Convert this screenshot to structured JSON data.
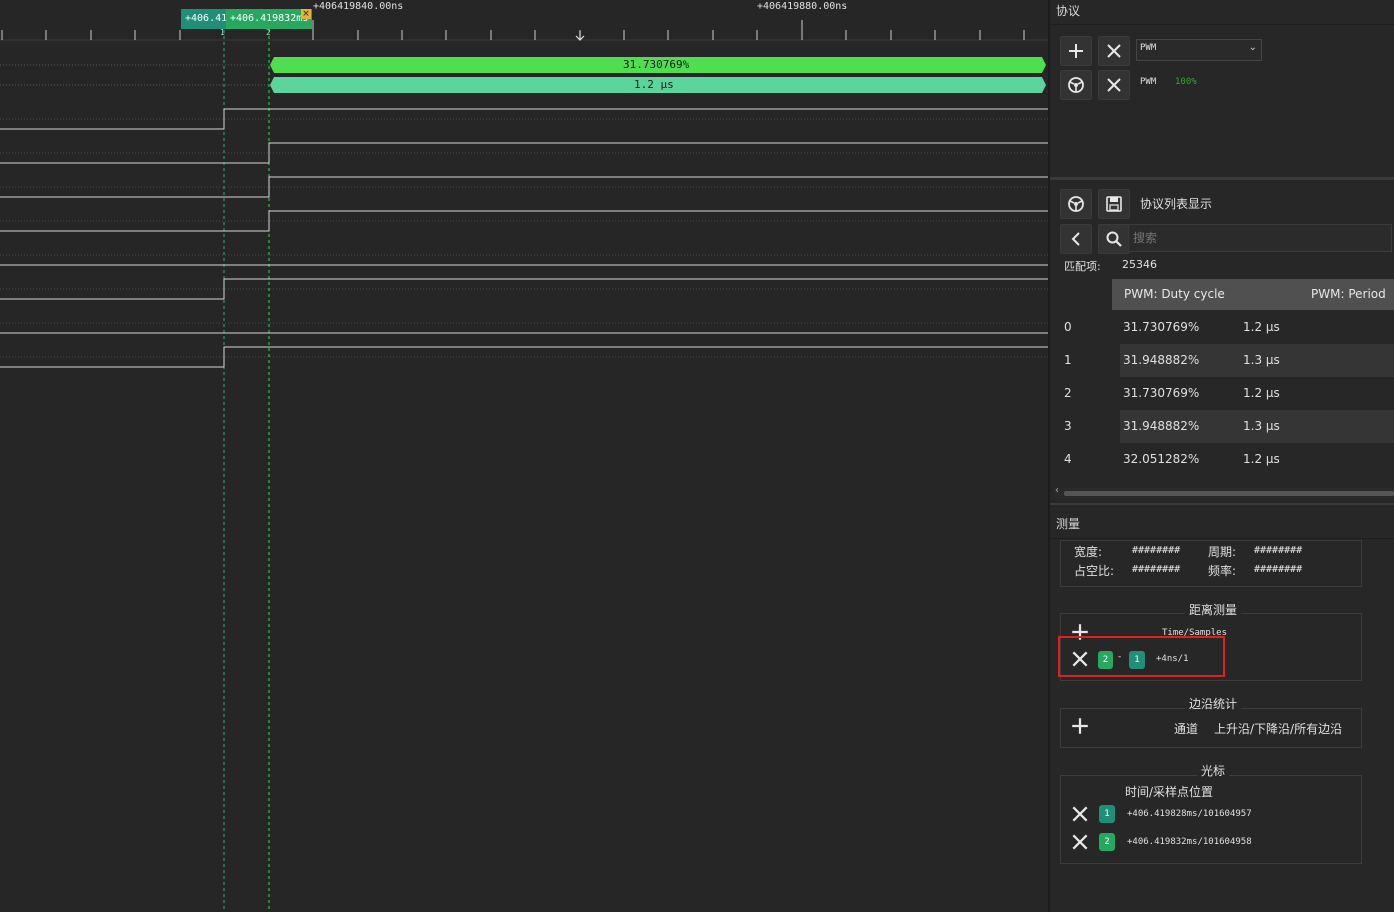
{
  "timeline": {
    "tick1": "+406419840.00ns",
    "tick2": "+406419880.00ns",
    "cursor1_flag": "+406.41",
    "cursor2_flag": "+406.419832ms",
    "cursor1_num": "1",
    "cursor2_num": "2"
  },
  "decode": {
    "duty_bar": "31.730769%",
    "period_bar": "1.2 μs"
  },
  "protocol": {
    "title": "协议",
    "select_value": "PWM",
    "decoder_name": "PWM",
    "decoder_progress": "100%"
  },
  "protocol_list": {
    "title": "协议列表显示",
    "search_placeholder": "搜索",
    "match_label": "匹配项:",
    "match_count": "25346",
    "columns": [
      "PWM: Duty cycle",
      "PWM: Period"
    ],
    "rows": [
      {
        "idx": "0",
        "duty": "31.730769%",
        "period": "1.2 μs"
      },
      {
        "idx": "1",
        "duty": "31.948882%",
        "period": "1.3 μs"
      },
      {
        "idx": "2",
        "duty": "31.730769%",
        "period": "1.2 μs"
      },
      {
        "idx": "3",
        "duty": "31.948882%",
        "period": "1.3 μs"
      },
      {
        "idx": "4",
        "duty": "32.051282%",
        "period": "1.2 μs"
      }
    ]
  },
  "measure": {
    "title": "测量",
    "width_label": "宽度:",
    "width_value": "########",
    "period_label": "周期:",
    "period_value": "########",
    "duty_label": "占空比:",
    "duty_value": "########",
    "freq_label": "频率:",
    "freq_value": "########"
  },
  "distance": {
    "title": "距离测量",
    "header": "Time/Samples",
    "from": "2",
    "to": "1",
    "result": "+4ns/1"
  },
  "edge": {
    "title": "边沿统计",
    "channel_label": "通道",
    "edges_label": "上升沿/下降沿/所有边沿"
  },
  "cursor": {
    "title": "光标",
    "header": "时间/采样点位置",
    "items": [
      {
        "num": "1",
        "value": "+406.419828ms/101604957"
      },
      {
        "num": "2",
        "value": "+406.419832ms/101604958"
      }
    ]
  }
}
